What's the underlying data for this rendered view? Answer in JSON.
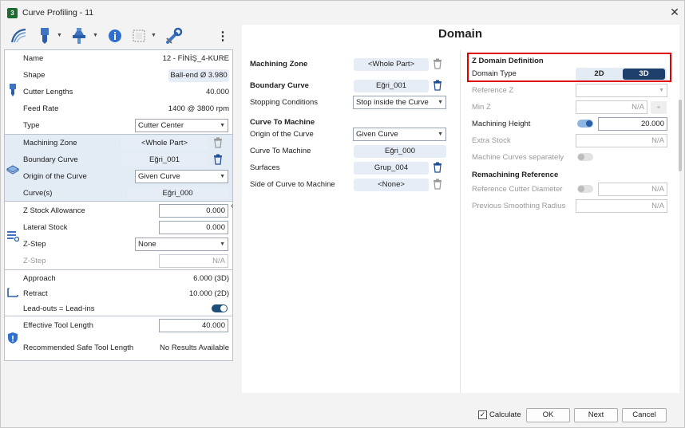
{
  "window": {
    "title": "Curve Profiling - 11",
    "close_glyph": "✕",
    "app_icon_text": "3"
  },
  "toolbar": {
    "items": [
      "toolpath-strategy-icon",
      "cutter-icon",
      "holder-icon",
      "info-icon",
      "stock-icon",
      "wrench-icon",
      "more-icon"
    ],
    "more_glyph": "⋮"
  },
  "left": {
    "tool": {
      "name_label": "Name",
      "name_value": "12 - FİNİŞ_4-KURE",
      "shape_label": "Shape",
      "shape_value": "Ball-end Ø 3.980",
      "lengths_label": "Cutter Lengths",
      "lengths_value": "40.000",
      "feed_label": "Feed Rate",
      "feed_value": "1400 @ 3800 rpm",
      "type_label": "Type",
      "type_value": "Cutter Center"
    },
    "zone": {
      "mz_label": "Machining Zone",
      "mz_value": "<Whole Part>",
      "bc_label": "Boundary Curve",
      "bc_value": "Eğri_001",
      "origin_label": "Origin of the Curve",
      "origin_value": "Given Curve",
      "curves_label": "Curve(s)",
      "curves_value": "Eğri_000"
    },
    "stock": {
      "zstock_label": "Z Stock Allowance",
      "zstock_value": "0.000",
      "lateral_label": "Lateral Stock",
      "lateral_value": "0.000",
      "zstep_label": "Z-Step",
      "zstep_value": "None",
      "zstep2_label": "Z-Step",
      "zstep2_value": "N/A"
    },
    "links": {
      "approach_label": "Approach",
      "approach_value": "6.000 (3D)",
      "retract_label": "Retract",
      "retract_value": "10.000 (2D)",
      "leadouts_label": "Lead-outs = Lead-ins"
    },
    "safety": {
      "etl_label": "Effective Tool Length",
      "etl_value": "40.000",
      "rstl_label": "Recommended Safe Tool Length",
      "rstl_value": "No Results Available"
    },
    "collapse_glyph": "‹"
  },
  "domain": {
    "title": "Domain",
    "mz_label": "Machining Zone",
    "mz_value": "<Whole Part>",
    "bc_label": "Boundary Curve",
    "bc_value": "Eğri_001",
    "stop_label": "Stopping Conditions",
    "stop_value": "Stop inside the Curve",
    "ctm_heading": "Curve To Machine",
    "origin_label": "Origin of the Curve",
    "origin_value": "Given Curve",
    "ctm_label": "Curve To Machine",
    "ctm_value": "Eğri_000",
    "surf_label": "Surfaces",
    "surf_value": "Grup_004",
    "side_label": "Side of Curve to Machine",
    "side_value": "<None>"
  },
  "zdomain": {
    "heading": "Z Domain Definition",
    "type_label": "Domain Type",
    "opt_2d": "2D",
    "opt_3d": "3D",
    "selected": "3D",
    "refz_label": "Reference Z",
    "refz_value": "",
    "minz_label": "Min Z",
    "minz_value": "N/A",
    "mh_label": "Machining Height",
    "mh_value": "20.000",
    "extra_label": "Extra Stock",
    "extra_value": "N/A",
    "mcs_label": "Machine Curves separately",
    "remach_heading": "Remachining Reference",
    "rcd_label": "Reference Cutter Diameter",
    "rcd_value": "N/A",
    "psr_label": "Previous Smoothing Radius",
    "psr_value": "N/A"
  },
  "footer": {
    "calc_label": "Calculate",
    "calc_checked": true,
    "check_glyph": "✓",
    "ok": "OK",
    "next": "Next",
    "cancel": "Cancel"
  },
  "colors": {
    "accent": "#1f4e79",
    "highlight": "#e3ebf5",
    "alert": "#e00000"
  }
}
